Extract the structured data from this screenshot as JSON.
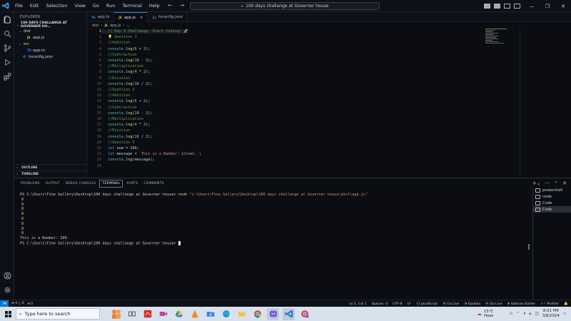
{
  "titlebar": {
    "menu": [
      "File",
      "Edit",
      "Selection",
      "View",
      "Go",
      "Run",
      "Terminal",
      "Help"
    ],
    "command_center": "100 days challange at Governer house"
  },
  "explorer": {
    "title": "EXPLORER",
    "folder": "100 DAYS CHALLANGE AT GOVERNER HO...",
    "tree": [
      {
        "label": "dist",
        "type": "folder",
        "depth": 1
      },
      {
        "label": "app.js",
        "type": "js",
        "depth": 2
      },
      {
        "label": "src",
        "type": "folder",
        "depth": 1
      },
      {
        "label": "app.ts",
        "type": "ts",
        "depth": 2
      },
      {
        "label": "tsconfig.json",
        "type": "json",
        "depth": 1
      }
    ],
    "outline": "OUTLINE",
    "timeline": "TIMELINE"
  },
  "tabs": [
    {
      "label": "app.ts",
      "icon": "TS"
    },
    {
      "label": "app.js",
      "icon": "JS"
    },
    {
      "label": "tsconfig.json",
      "icon": "{}"
    }
  ],
  "breadcrumb": {
    "folder": "dist",
    "file": "app.js",
    "tail": "..."
  },
  "editor": {
    "lines": [
      "// Day 3 Challenge: Start Coding!",
      "Question 1",
      "//Addition",
      "console.log(6 + 2);",
      "//Subtraction",
      "console.log(10 - 2);",
      "//Multiplication",
      "console.log(4 * 2);",
      "//Division",
      "console.log(16 / 2);",
      "//Question 2",
      "//Addition",
      "console.log(6 + 2);",
      "//Subtraction",
      "console.log(10 - 2);",
      "//Multiplication",
      "console.log(4 * 2);",
      "//Division",
      "console.log(16 / 2);",
      "//Question 3",
      "let num = 100;",
      "let message = `This is a Number: ${num}.`;",
      "console.log(message);",
      ""
    ]
  },
  "panel": {
    "tabs": [
      "PROBLEMS",
      "OUTPUT",
      "DEBUG CONSOLE",
      "TERMINAL",
      "PORTS",
      "COMMENTS"
    ],
    "active_tab": "TERMINAL",
    "prompt": "PS C:\\Users\\Fine Gallery\\Desktop\\100 days challange at Governer house>",
    "command": "node",
    "command_arg": "\"c:\\Users\\Fine Gallery\\Desktop\\100 days challange at Governer house\\dist\\app.js\"",
    "outputs": [
      "8",
      "8",
      "8",
      "8",
      "8",
      "8",
      "8",
      "8"
    ],
    "message": "This is a Number: 100.",
    "terminals": [
      "powershell",
      "node",
      "Code",
      "Code"
    ]
  },
  "statusbar": {
    "errors": "0",
    "warnings": "0",
    "ports": "0",
    "position": "Ln 1, Col 1",
    "spaces": "Spaces: 4",
    "encoding": "UTF-8",
    "eol": "LF",
    "language": "JavaScript",
    "golive1": "Go Live",
    "quokka": "Quokka",
    "golive2": "Go Live",
    "tabnine": "tabnine starter",
    "prettier": "Prettier"
  },
  "taskbar": {
    "search_placeholder": "Type here to search",
    "weather_temp": "15°C",
    "weather_desc": "Haze",
    "time": "8:01 PM",
    "date": "3/8/2024"
  }
}
